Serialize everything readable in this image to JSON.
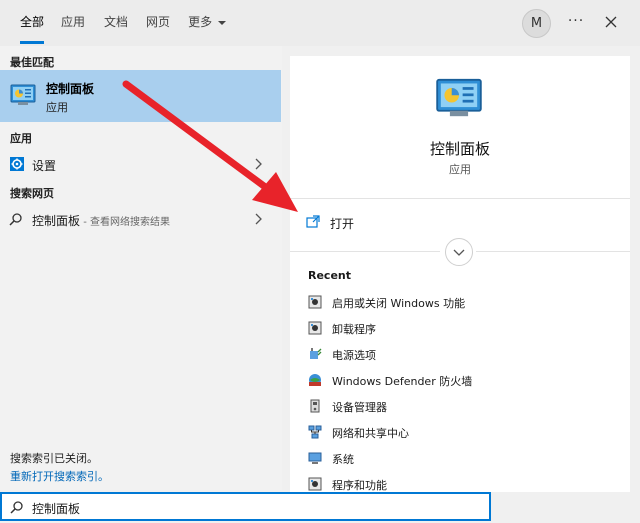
{
  "tabs": [
    {
      "label": "全部",
      "active": true
    },
    {
      "label": "应用",
      "active": false
    },
    {
      "label": "文档",
      "active": false
    },
    {
      "label": "网页",
      "active": false
    },
    {
      "label": "更多",
      "active": false
    }
  ],
  "account": {
    "initial": "M"
  },
  "more_options": "···",
  "best_match": {
    "section_label": "最佳匹配",
    "title": "控制面板",
    "subtitle": "应用"
  },
  "apps": {
    "section_label": "应用",
    "items": [
      {
        "label": "设置",
        "icon": "gear-icon"
      }
    ]
  },
  "web": {
    "section_label": "搜索网页",
    "query": "控制面板",
    "suffix": " - 查看网络搜索结果"
  },
  "index_status": {
    "line1": "搜索索引已关闭。",
    "link": "重新打开搜索索引。"
  },
  "preview": {
    "title": "控制面板",
    "subtitle": "应用",
    "open_label": "打开",
    "recent_label": "Recent",
    "recent": [
      {
        "label": "启用或关闭 Windows 功能",
        "icon": "windows-features-icon"
      },
      {
        "label": "卸载程序",
        "icon": "uninstall-icon"
      },
      {
        "label": "电源选项",
        "icon": "power-options-icon"
      },
      {
        "label": "Windows Defender 防火墙",
        "icon": "firewall-icon"
      },
      {
        "label": "设备管理器",
        "icon": "device-manager-icon"
      },
      {
        "label": "网络和共享中心",
        "icon": "network-icon"
      },
      {
        "label": "系统",
        "icon": "system-icon"
      },
      {
        "label": "程序和功能",
        "icon": "programs-icon"
      }
    ]
  },
  "search": {
    "value": "控制面板"
  },
  "colors": {
    "accent": "#0078d4",
    "selected_bg": "#a9cfee",
    "annotation_arrow": "#e8232a"
  }
}
